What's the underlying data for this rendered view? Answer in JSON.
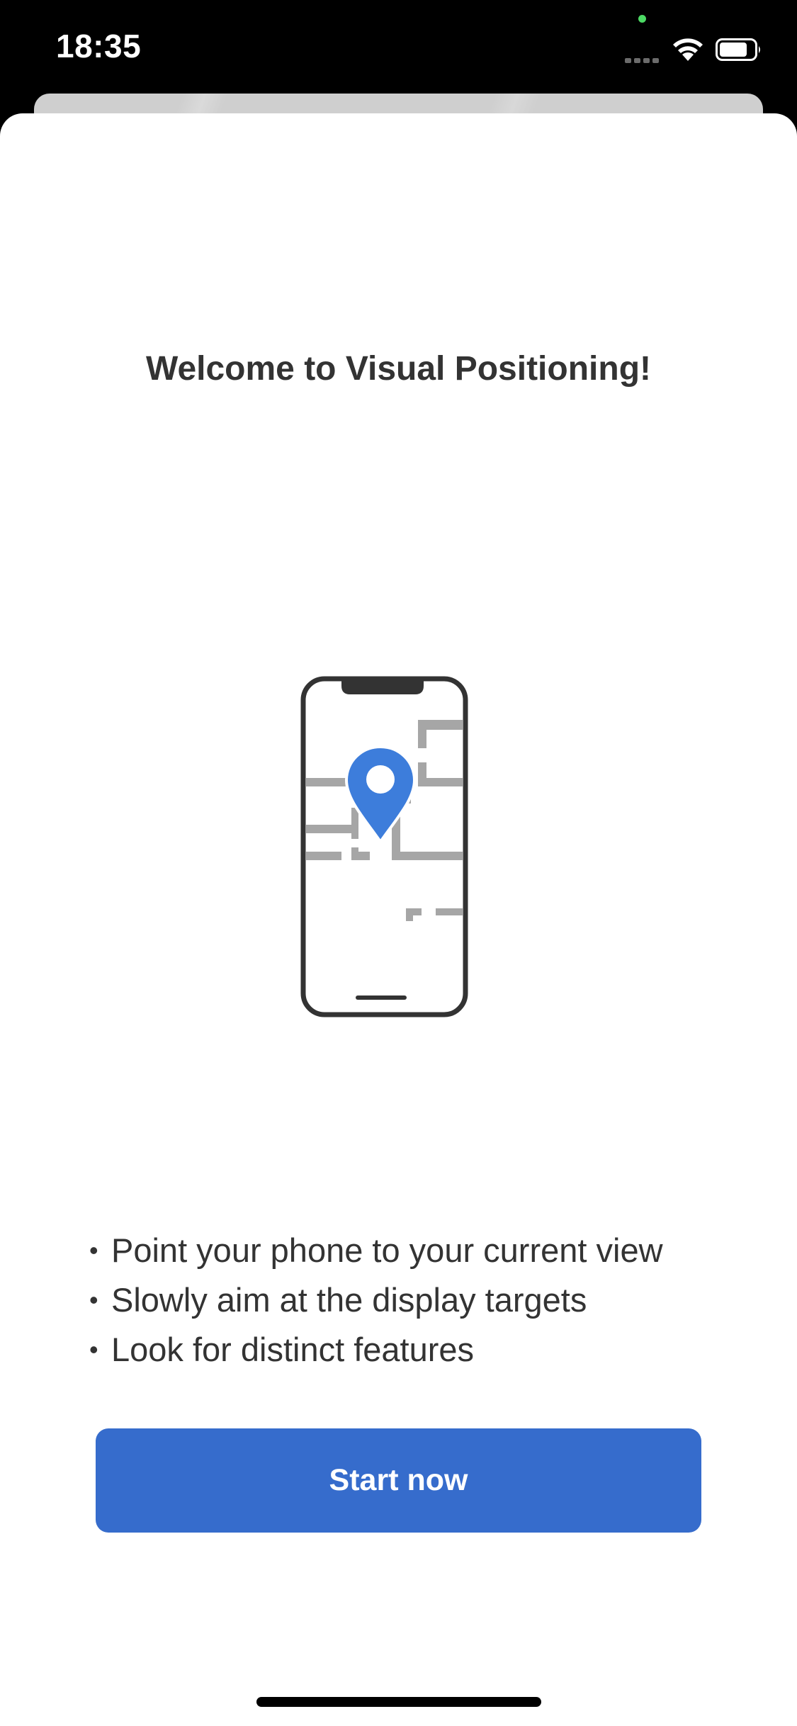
{
  "status_bar": {
    "time": "18:35",
    "icons": [
      "signal-icon",
      "wifi-icon",
      "battery-icon"
    ]
  },
  "onboarding": {
    "title": "Welcome to Visual Positioning!",
    "illustration_icon": "phone-map-pin-illustration",
    "instructions": [
      "Point your phone to your current view",
      "Slowly aim at the display targets",
      "Look for distinct features"
    ],
    "start_button_label": "Start now"
  },
  "colors": {
    "accent": "#366ccc",
    "pin": "#3d7ddb",
    "text": "#333333",
    "map_lines": "#a6a6a6",
    "phone_outline": "#333333"
  }
}
